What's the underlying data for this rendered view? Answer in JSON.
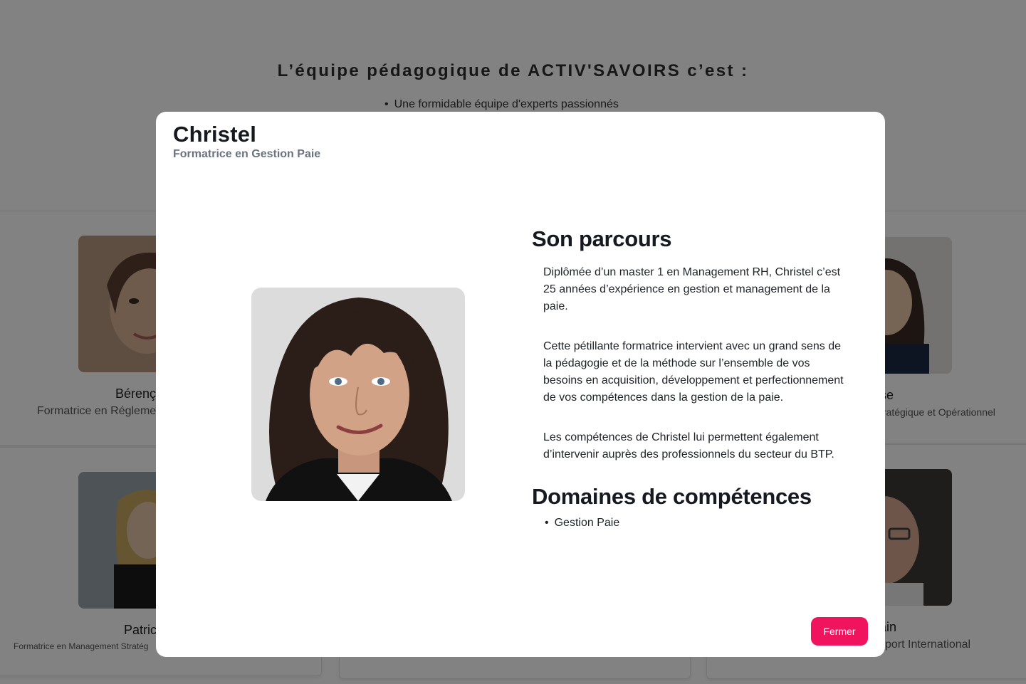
{
  "background": {
    "heading": "L’équipe pédagogique de ACTIV'SAVOIRS c’est :",
    "bullets": [
      "Une formidable équipe d'experts passionnés"
    ],
    "cards": [
      {
        "name": "Bérenç",
        "role": "Formatrice en Régleme"
      },
      {
        "name": "se",
        "role": "tratégique et Opérationnel"
      },
      {
        "name": "Patric",
        "role": "Formatrice en Management Stratég"
      },
      {
        "name": "ain",
        "role": "sport International"
      }
    ]
  },
  "modal": {
    "name": "Christel",
    "role": "Formatrice en Gestion Paie",
    "parcours_title": "Son parcours",
    "paragraphs": [
      "Diplômée d’un master 1 en Management RH, Christel c’est 25 années d’expérience en gestion et management de la paie.",
      "Cette pétillante formatrice intervient avec un grand sens de la pédagogie et de la méthode sur l’ensemble de vos besoins en acquisition, développement et perfectionnement de vos compétences dans la gestion de la paie.",
      "Les compétences de Christel lui permettent également d’intervenir auprès des professionnels du secteur du BTP."
    ],
    "domaines_title": "Domaines de compétences",
    "domaines": [
      "Gestion Paie"
    ],
    "close_label": "Fermer"
  },
  "colors": {
    "accent": "#f0145e",
    "heading": "#16191f",
    "subtitle": "#6b7280",
    "overlay": "rgba(0,0,0,0.49)"
  }
}
